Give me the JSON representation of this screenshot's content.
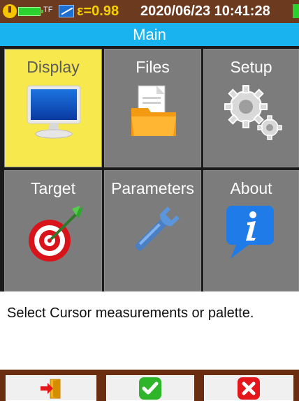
{
  "status": {
    "power_icon": "power-icon",
    "battery_icon": "battery-icon",
    "storage_label": "TF",
    "camera_icon": "camera-icon",
    "emissivity": "ε=0.98",
    "datetime": "2020/06/23 10:41:28",
    "sd_icon": "sd-card-icon"
  },
  "title": "Main",
  "menu": [
    {
      "label": "Display",
      "icon": "monitor-icon",
      "selected": true
    },
    {
      "label": "Files",
      "icon": "folder-icon",
      "selected": false
    },
    {
      "label": "Setup",
      "icon": "gears-icon",
      "selected": false
    },
    {
      "label": "Target",
      "icon": "target-icon",
      "selected": false
    },
    {
      "label": "Parameters",
      "icon": "wrench-icon",
      "selected": false
    },
    {
      "label": "About",
      "icon": "info-icon",
      "selected": false
    }
  ],
  "message": "Select Cursor measurements or palette.",
  "softkeys": [
    {
      "icon": "exit-icon"
    },
    {
      "icon": "check-icon"
    },
    {
      "icon": "cancel-icon"
    }
  ],
  "colors": {
    "status_bg": "#6b3a1f",
    "title_bg": "#19b4f0",
    "tile_bg": "#7c7c7c",
    "tile_selected_bg": "#f7e94d",
    "bottom_bg": "#6b2d12",
    "emissivity_text": "#f6d000"
  }
}
